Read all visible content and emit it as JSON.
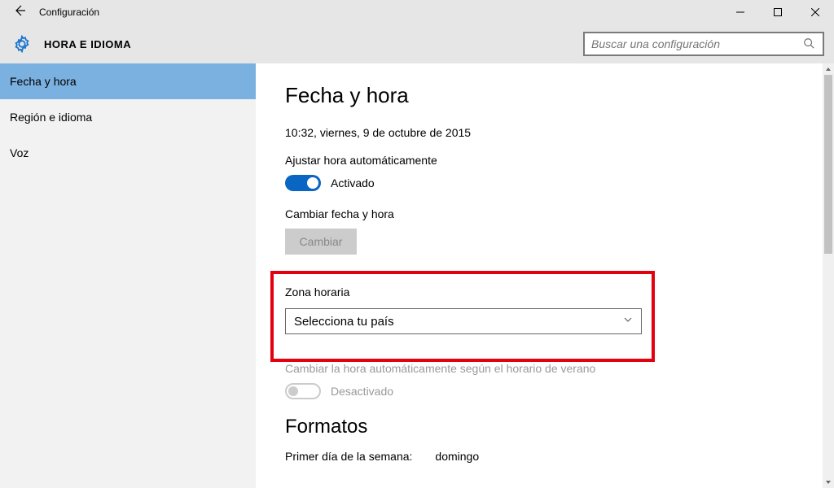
{
  "titlebar": {
    "title": "Configuración"
  },
  "header": {
    "section": "HORA E IDIOMA",
    "search_placeholder": "Buscar una configuración"
  },
  "sidebar": {
    "items": [
      {
        "label": "Fecha y hora",
        "active": true
      },
      {
        "label": "Región e idioma",
        "active": false
      },
      {
        "label": "Voz",
        "active": false
      }
    ]
  },
  "content": {
    "heading": "Fecha y hora",
    "datetime": "10:32, viernes, 9 de octubre de 2015",
    "auto_label": "Ajustar hora automáticamente",
    "auto_state": "Activado",
    "change_label": "Cambiar fecha y hora",
    "change_button": "Cambiar",
    "tz_label": "Zona horaria",
    "tz_value": "Selecciona tu país",
    "dst_label": "Cambiar la hora automáticamente según el horario de verano",
    "dst_state": "Desactivado",
    "formats_heading": "Formatos",
    "first_day_label": "Primer día de la semana:",
    "first_day_value": "domingo"
  }
}
